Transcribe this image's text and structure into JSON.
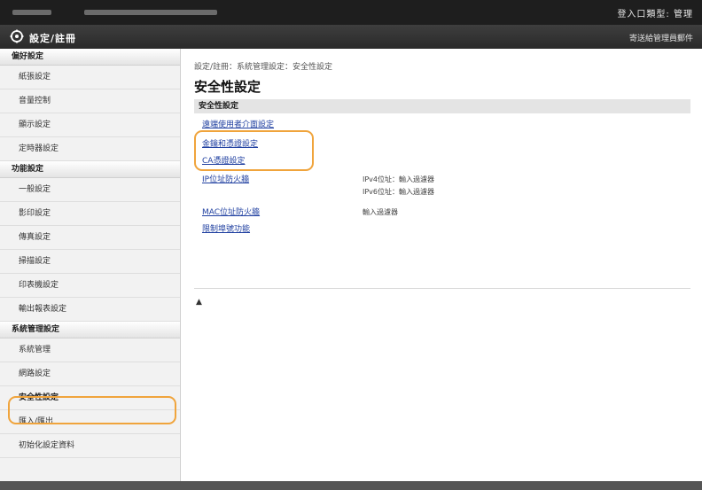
{
  "header": {
    "user_status": "登入口類型: 管理",
    "app_title": "設定/註冊",
    "admin_mail": "寄送給管理員郵件"
  },
  "sidebar": {
    "sections": [
      {
        "title": "偏好設定",
        "items": [
          "紙張設定",
          "音量控制",
          "顯示設定",
          "定時器設定"
        ]
      },
      {
        "title": "功能設定",
        "items": [
          "一般設定",
          "影印設定",
          "傳真設定",
          "掃描設定",
          "印表機設定",
          "輸出報表設定"
        ]
      },
      {
        "title": "系統管理設定",
        "items": [
          "系統管理",
          "網路設定",
          "安全性設定",
          "匯入/匯出",
          "初始化設定資料"
        ]
      }
    ],
    "active_item": "安全性設定"
  },
  "main": {
    "breadcrumb": "設定/註冊：系統管理設定：安全性設定",
    "page_title": "安全性設定",
    "section_title": "安全性設定",
    "links": [
      {
        "label": "遠端使用者介面設定",
        "value": ""
      },
      {
        "label": "金鑰和憑證設定",
        "value": ""
      },
      {
        "label": "CA憑證設定",
        "value": ""
      },
      {
        "label": "IP位址防火牆",
        "value": "IPv4位址：輸入過濾器"
      },
      {
        "label": "",
        "value": "IPv6位址：輸入過濾器"
      },
      {
        "label": "MAC位址防火牆",
        "value": "輸入過濾器"
      },
      {
        "label": "限制埠號功能",
        "value": ""
      }
    ],
    "top_icon": "▲"
  },
  "colors": {
    "highlight": "#f0a43c",
    "link": "#1f3fa0",
    "topbar": "#1e1e1e"
  },
  "icons": {
    "title_icon": "gear-icon",
    "top_link": "arrow-up-icon"
  }
}
